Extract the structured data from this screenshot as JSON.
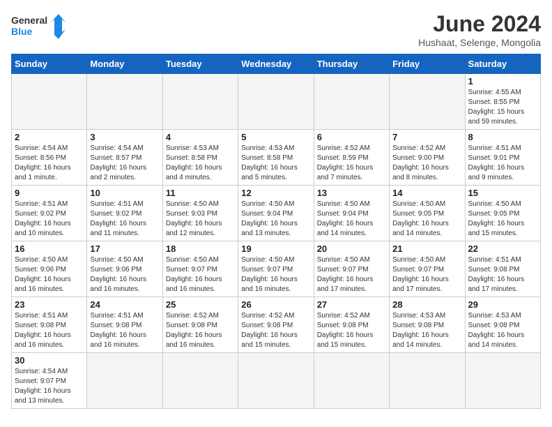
{
  "header": {
    "logo_general": "General",
    "logo_blue": "Blue",
    "month_title": "June 2024",
    "subtitle": "Hushaat, Selenge, Mongolia"
  },
  "days_of_week": [
    "Sunday",
    "Monday",
    "Tuesday",
    "Wednesday",
    "Thursday",
    "Friday",
    "Saturday"
  ],
  "weeks": [
    [
      {
        "day": "",
        "info": "",
        "empty": true
      },
      {
        "day": "",
        "info": "",
        "empty": true
      },
      {
        "day": "",
        "info": "",
        "empty": true
      },
      {
        "day": "",
        "info": "",
        "empty": true
      },
      {
        "day": "",
        "info": "",
        "empty": true
      },
      {
        "day": "",
        "info": "",
        "empty": true
      },
      {
        "day": "1",
        "info": "Sunrise: 4:55 AM\nSunset: 8:55 PM\nDaylight: 15 hours\nand 59 minutes.",
        "empty": false
      }
    ],
    [
      {
        "day": "2",
        "info": "Sunrise: 4:54 AM\nSunset: 8:56 PM\nDaylight: 16 hours\nand 1 minute.",
        "empty": false
      },
      {
        "day": "3",
        "info": "Sunrise: 4:54 AM\nSunset: 8:57 PM\nDaylight: 16 hours\nand 2 minutes.",
        "empty": false
      },
      {
        "day": "4",
        "info": "Sunrise: 4:53 AM\nSunset: 8:58 PM\nDaylight: 16 hours\nand 4 minutes.",
        "empty": false
      },
      {
        "day": "5",
        "info": "Sunrise: 4:53 AM\nSunset: 8:58 PM\nDaylight: 16 hours\nand 5 minutes.",
        "empty": false
      },
      {
        "day": "6",
        "info": "Sunrise: 4:52 AM\nSunset: 8:59 PM\nDaylight: 16 hours\nand 7 minutes.",
        "empty": false
      },
      {
        "day": "7",
        "info": "Sunrise: 4:52 AM\nSunset: 9:00 PM\nDaylight: 16 hours\nand 8 minutes.",
        "empty": false
      },
      {
        "day": "8",
        "info": "Sunrise: 4:51 AM\nSunset: 9:01 PM\nDaylight: 16 hours\nand 9 minutes.",
        "empty": false
      }
    ],
    [
      {
        "day": "9",
        "info": "Sunrise: 4:51 AM\nSunset: 9:02 PM\nDaylight: 16 hours\nand 10 minutes.",
        "empty": false
      },
      {
        "day": "10",
        "info": "Sunrise: 4:51 AM\nSunset: 9:02 PM\nDaylight: 16 hours\nand 11 minutes.",
        "empty": false
      },
      {
        "day": "11",
        "info": "Sunrise: 4:50 AM\nSunset: 9:03 PM\nDaylight: 16 hours\nand 12 minutes.",
        "empty": false
      },
      {
        "day": "12",
        "info": "Sunrise: 4:50 AM\nSunset: 9:04 PM\nDaylight: 16 hours\nand 13 minutes.",
        "empty": false
      },
      {
        "day": "13",
        "info": "Sunrise: 4:50 AM\nSunset: 9:04 PM\nDaylight: 16 hours\nand 14 minutes.",
        "empty": false
      },
      {
        "day": "14",
        "info": "Sunrise: 4:50 AM\nSunset: 9:05 PM\nDaylight: 16 hours\nand 14 minutes.",
        "empty": false
      },
      {
        "day": "15",
        "info": "Sunrise: 4:50 AM\nSunset: 9:05 PM\nDaylight: 16 hours\nand 15 minutes.",
        "empty": false
      }
    ],
    [
      {
        "day": "16",
        "info": "Sunrise: 4:50 AM\nSunset: 9:06 PM\nDaylight: 16 hours\nand 16 minutes.",
        "empty": false
      },
      {
        "day": "17",
        "info": "Sunrise: 4:50 AM\nSunset: 9:06 PM\nDaylight: 16 hours\nand 16 minutes.",
        "empty": false
      },
      {
        "day": "18",
        "info": "Sunrise: 4:50 AM\nSunset: 9:07 PM\nDaylight: 16 hours\nand 16 minutes.",
        "empty": false
      },
      {
        "day": "19",
        "info": "Sunrise: 4:50 AM\nSunset: 9:07 PM\nDaylight: 16 hours\nand 16 minutes.",
        "empty": false
      },
      {
        "day": "20",
        "info": "Sunrise: 4:50 AM\nSunset: 9:07 PM\nDaylight: 16 hours\nand 17 minutes.",
        "empty": false
      },
      {
        "day": "21",
        "info": "Sunrise: 4:50 AM\nSunset: 9:07 PM\nDaylight: 16 hours\nand 17 minutes.",
        "empty": false
      },
      {
        "day": "22",
        "info": "Sunrise: 4:51 AM\nSunset: 9:08 PM\nDaylight: 16 hours\nand 17 minutes.",
        "empty": false
      }
    ],
    [
      {
        "day": "23",
        "info": "Sunrise: 4:51 AM\nSunset: 9:08 PM\nDaylight: 16 hours\nand 16 minutes.",
        "empty": false
      },
      {
        "day": "24",
        "info": "Sunrise: 4:51 AM\nSunset: 9:08 PM\nDaylight: 16 hours\nand 16 minutes.",
        "empty": false
      },
      {
        "day": "25",
        "info": "Sunrise: 4:52 AM\nSunset: 9:08 PM\nDaylight: 16 hours\nand 16 minutes.",
        "empty": false
      },
      {
        "day": "26",
        "info": "Sunrise: 4:52 AM\nSunset: 9:08 PM\nDaylight: 16 hours\nand 15 minutes.",
        "empty": false
      },
      {
        "day": "27",
        "info": "Sunrise: 4:52 AM\nSunset: 9:08 PM\nDaylight: 16 hours\nand 15 minutes.",
        "empty": false
      },
      {
        "day": "28",
        "info": "Sunrise: 4:53 AM\nSunset: 9:08 PM\nDaylight: 16 hours\nand 14 minutes.",
        "empty": false
      },
      {
        "day": "29",
        "info": "Sunrise: 4:53 AM\nSunset: 9:08 PM\nDaylight: 16 hours\nand 14 minutes.",
        "empty": false
      }
    ],
    [
      {
        "day": "30",
        "info": "Sunrise: 4:54 AM\nSunset: 9:07 PM\nDaylight: 16 hours\nand 13 minutes.",
        "empty": false
      },
      {
        "day": "",
        "info": "",
        "empty": true
      },
      {
        "day": "",
        "info": "",
        "empty": true
      },
      {
        "day": "",
        "info": "",
        "empty": true
      },
      {
        "day": "",
        "info": "",
        "empty": true
      },
      {
        "day": "",
        "info": "",
        "empty": true
      },
      {
        "day": "",
        "info": "",
        "empty": true
      }
    ]
  ]
}
